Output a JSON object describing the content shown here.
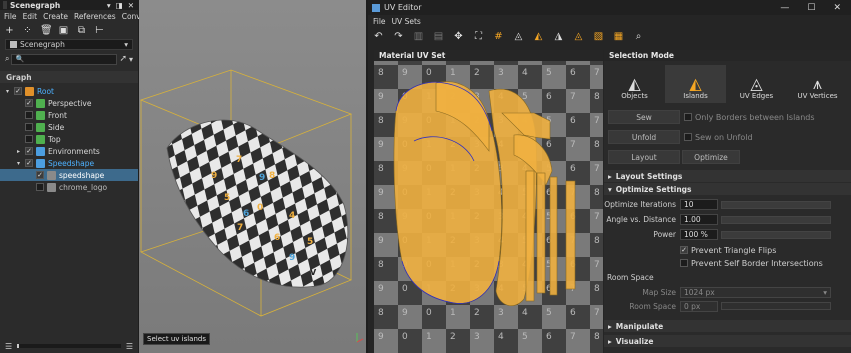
{
  "scenegraph": {
    "tab_title": "Scenegraph",
    "menu": [
      "File",
      "Edit",
      "Create",
      "References",
      "Convert"
    ],
    "combo_value": "Scenegraph",
    "search_placeholder": "",
    "graph_header": "Graph",
    "tree": [
      {
        "label": "Root",
        "indent": 0,
        "expanded": true,
        "checked": true,
        "icon": "root-icon",
        "color": "#4db1ff"
      },
      {
        "label": "Perspective",
        "indent": 1,
        "checked": true,
        "icon": "camera-icon",
        "color": "#d8d8d8"
      },
      {
        "label": "Front",
        "indent": 1,
        "checked": false,
        "icon": "camera-icon",
        "color": "#d8d8d8"
      },
      {
        "label": "Side",
        "indent": 1,
        "checked": false,
        "icon": "camera-icon",
        "color": "#d8d8d8"
      },
      {
        "label": "Top",
        "indent": 1,
        "checked": false,
        "icon": "camera-icon",
        "color": "#d8d8d8"
      },
      {
        "label": "Environments",
        "indent": 1,
        "expanded": false,
        "checked": true,
        "icon": "environment-icon",
        "color": "#d8d8d8"
      },
      {
        "label": "Speedshape",
        "indent": 1,
        "expanded": true,
        "checked": true,
        "icon": "group-icon",
        "color": "#4db1ff"
      },
      {
        "label": "speedshape",
        "indent": 2,
        "checked": true,
        "icon": "mesh-icon",
        "color": "#ffffff",
        "selected": true
      },
      {
        "label": "chrome_logo",
        "indent": 2,
        "checked": false,
        "icon": "mesh-icon",
        "color": "#bdbdbd"
      }
    ]
  },
  "viewport": {
    "tooltip": "Select uv islands"
  },
  "uv_editor": {
    "title": "UV Editor",
    "menu": [
      "File",
      "UV Sets"
    ],
    "uvset_header": "Material UV Set",
    "grid_labels": [
      [
        "8",
        "9",
        "0",
        "1",
        "2",
        "3",
        "4",
        "5",
        "6",
        "7"
      ],
      [
        "9",
        "0",
        "1",
        "2",
        "3",
        "4",
        "5",
        "6",
        "7",
        "8"
      ]
    ],
    "selection_mode": {
      "header": "Selection Mode",
      "modes": [
        {
          "label": "Objects",
          "icon": "objects-mode-icon",
          "active": false
        },
        {
          "label": "Islands",
          "icon": "islands-mode-icon",
          "active": true
        },
        {
          "label": "UV Edges",
          "icon": "uv-edges-mode-icon",
          "active": false
        },
        {
          "label": "UV Vertices",
          "icon": "uv-vertices-mode-icon",
          "active": false
        }
      ]
    },
    "actions": {
      "sew": "Sew",
      "only_borders": "Only Borders between Islands",
      "unfold": "Unfold",
      "sew_on_unfold": "Sew on Unfold",
      "layout": "Layout",
      "optimize": "Optimize"
    },
    "sections": {
      "layout_settings": "Layout Settings",
      "optimize_settings": "Optimize Settings",
      "manipulate": "Manipulate",
      "visualize": "Visualize"
    },
    "optimize": {
      "iterations_label": "Optimize Iterations",
      "iterations_value": "10",
      "iterations_fill": 1.0,
      "angle_label": "Angle vs. Distance",
      "angle_value": "1.00",
      "angle_fill": 1.0,
      "power_label": "Power",
      "power_value": "100 %",
      "power_fill": 1.0,
      "prevent_flips": "Prevent Triangle Flips",
      "prevent_flips_checked": true,
      "prevent_self": "Prevent Self Border Intersections",
      "prevent_self_checked": false
    },
    "room_space": {
      "header": "Room Space",
      "map_size_label": "Map Size",
      "map_size_value": "1024 px",
      "room_space_label": "Room Space",
      "room_space_value": "0 px"
    },
    "colors": {
      "accent": "#f5a623",
      "selected_row": "#3d6a8c",
      "island_fill": "#f0b040"
    }
  }
}
